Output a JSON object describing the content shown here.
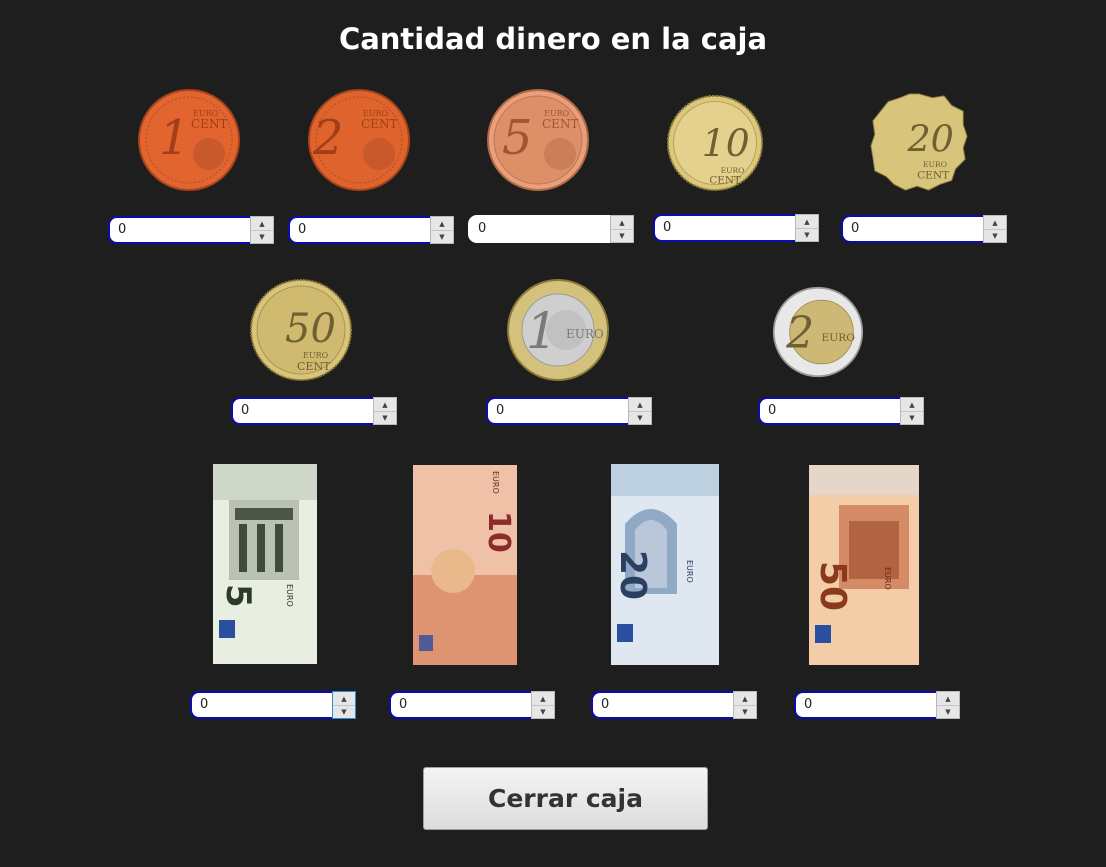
{
  "window": {
    "title": "Cantidad dinero en la caja"
  },
  "coins": [
    {
      "label": "1",
      "sub": "CENT",
      "top": "EURO",
      "value": "0"
    },
    {
      "label": "2",
      "sub": "CENT",
      "top": "EURO",
      "value": "0"
    },
    {
      "label": "5",
      "sub": "CENT",
      "top": "EURO",
      "value": "0"
    },
    {
      "label": "10",
      "sub": "CENT",
      "top": "EURO",
      "value": "0"
    },
    {
      "label": "20",
      "sub": "CENT",
      "top": "EURO",
      "value": "0"
    },
    {
      "label": "50",
      "sub": "CENT",
      "top": "EURO",
      "value": "0"
    },
    {
      "label": "1",
      "sub": "EURO",
      "top": "",
      "value": "0"
    },
    {
      "label": "2",
      "sub": "EURO",
      "top": "",
      "value": "0"
    }
  ],
  "notes": [
    {
      "label": "5",
      "currency": "EURO",
      "value": "0"
    },
    {
      "label": "10",
      "currency": "EURO",
      "value": "0"
    },
    {
      "label": "20",
      "currency": "EURO",
      "value": "0"
    },
    {
      "label": "50",
      "currency": "EURO",
      "value": "0"
    }
  ],
  "actions": {
    "close_label": "Cerrar caja"
  },
  "colors": {
    "background": "#1e1e1e",
    "field_border": "#0a0ab3",
    "copper": "#e8703a",
    "gold": "#d8c47a"
  },
  "icons": {
    "spin_up": "▲",
    "spin_down": "▼"
  }
}
